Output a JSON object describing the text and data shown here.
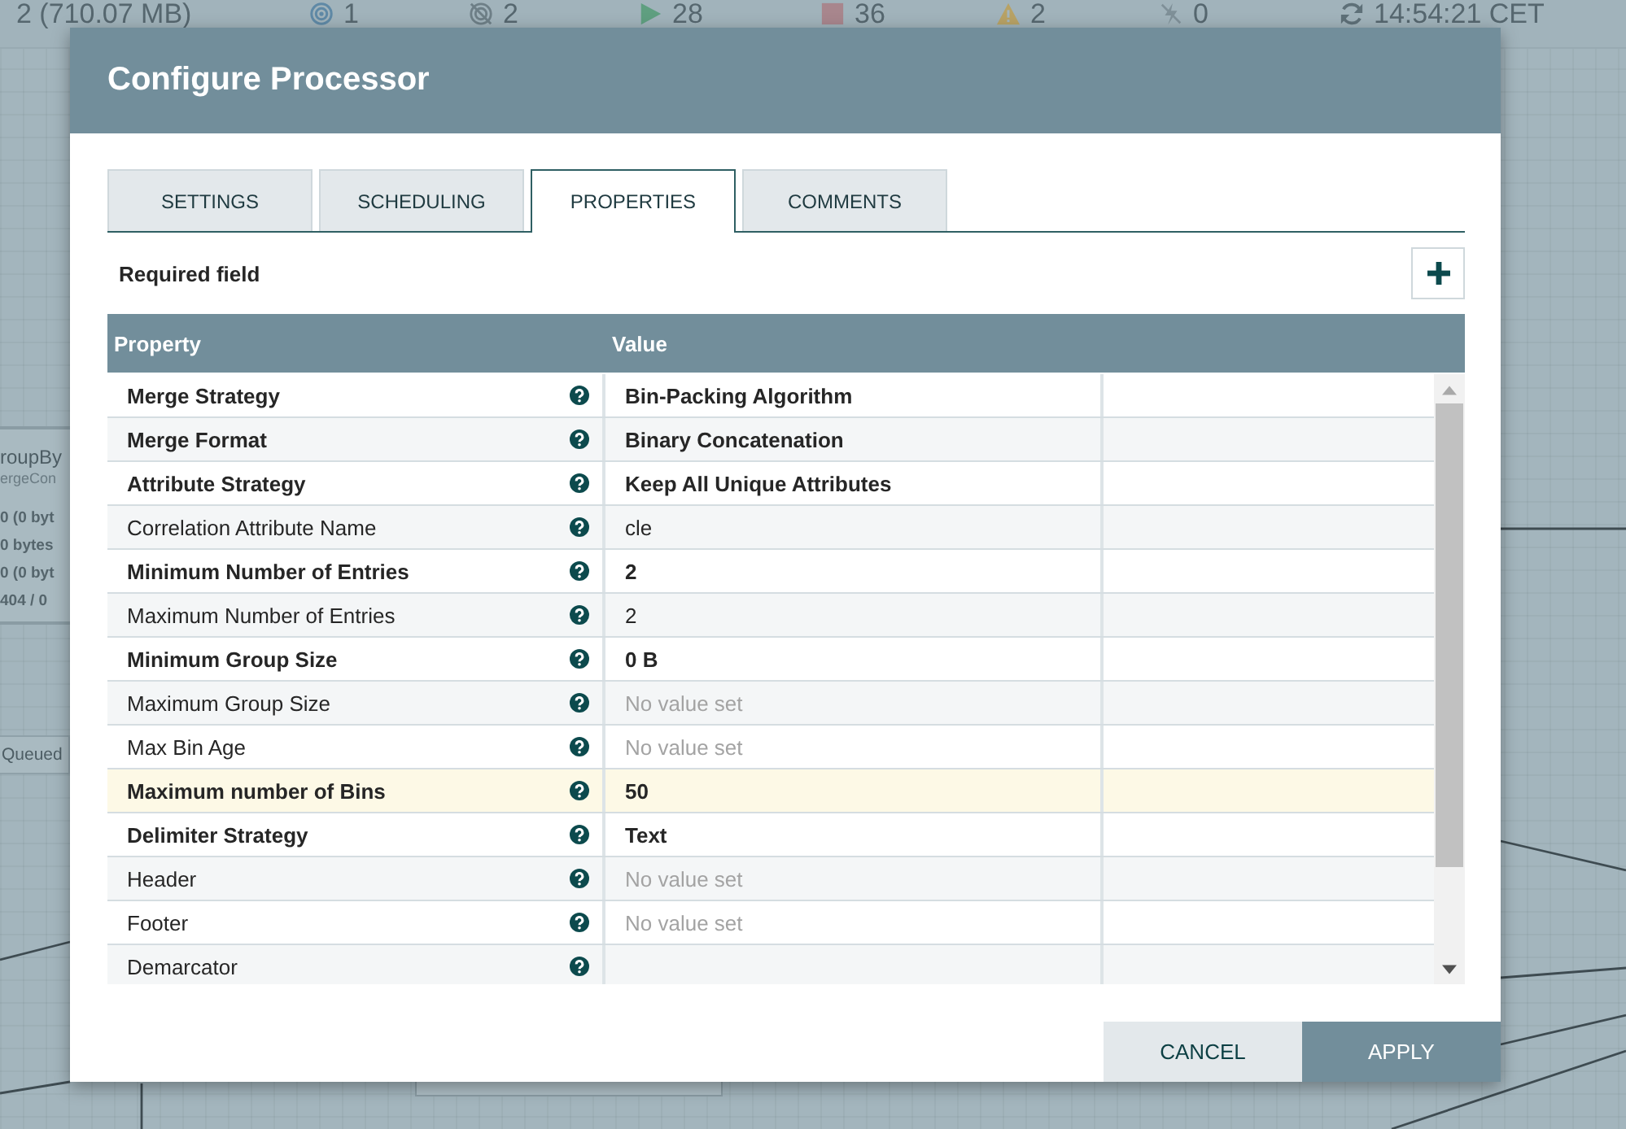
{
  "status_bar": {
    "items": [
      {
        "kind": "queued",
        "text": "2 (710.07 MB)"
      },
      {
        "kind": "transmitting",
        "text": "1"
      },
      {
        "kind": "nontransmitting",
        "text": "2"
      },
      {
        "kind": "running",
        "text": "28"
      },
      {
        "kind": "stopped",
        "text": "36"
      },
      {
        "kind": "invalid",
        "text": "2"
      },
      {
        "kind": "disabled",
        "text": "0"
      },
      {
        "kind": "refresh",
        "text": "14:54:21 CET"
      }
    ]
  },
  "canvas": {
    "processor": {
      "name": "roupBy",
      "type": "ergeCon",
      "stats": [
        "0 (0 byt",
        "0 bytes",
        "0 (0 byt",
        "404 / 0"
      ]
    },
    "queue_label": "Queued"
  },
  "dialog": {
    "title": "Configure Processor",
    "tabs": [
      {
        "label": "SETTINGS",
        "selected": false
      },
      {
        "label": "SCHEDULING",
        "selected": false
      },
      {
        "label": "PROPERTIES",
        "selected": true
      },
      {
        "label": "COMMENTS",
        "selected": false
      }
    ],
    "required_label": "Required field",
    "table": {
      "columns": [
        "Property",
        "Value"
      ],
      "rows": [
        {
          "property": "Merge Strategy",
          "value": "Bin-Packing Algorithm",
          "required": true,
          "set": true,
          "selected": false
        },
        {
          "property": "Merge Format",
          "value": "Binary Concatenation",
          "required": true,
          "set": true,
          "selected": false
        },
        {
          "property": "Attribute Strategy",
          "value": "Keep All Unique Attributes",
          "required": true,
          "set": true,
          "selected": false
        },
        {
          "property": "Correlation Attribute Name",
          "value": "cle",
          "required": false,
          "set": true,
          "selected": false
        },
        {
          "property": "Minimum Number of Entries",
          "value": "2",
          "required": true,
          "set": true,
          "selected": false
        },
        {
          "property": "Maximum Number of Entries",
          "value": "2",
          "required": false,
          "set": true,
          "selected": false
        },
        {
          "property": "Minimum Group Size",
          "value": "0 B",
          "required": true,
          "set": true,
          "selected": false
        },
        {
          "property": "Maximum Group Size",
          "value": "No value set",
          "required": false,
          "set": false,
          "selected": false
        },
        {
          "property": "Max Bin Age",
          "value": "No value set",
          "required": false,
          "set": false,
          "selected": false
        },
        {
          "property": "Maximum number of Bins",
          "value": "50",
          "required": true,
          "set": true,
          "selected": true
        },
        {
          "property": "Delimiter Strategy",
          "value": "Text",
          "required": true,
          "set": true,
          "selected": false
        },
        {
          "property": "Header",
          "value": "No value set",
          "required": false,
          "set": false,
          "selected": false
        },
        {
          "property": "Footer",
          "value": "No value set",
          "required": false,
          "set": false,
          "selected": false
        },
        {
          "property": "Demarcator",
          "required": false,
          "selected": false
        }
      ]
    },
    "buttons": [
      {
        "label": "CANCEL",
        "kind": "secondary"
      },
      {
        "label": "APPLY",
        "kind": "primary"
      }
    ]
  }
}
